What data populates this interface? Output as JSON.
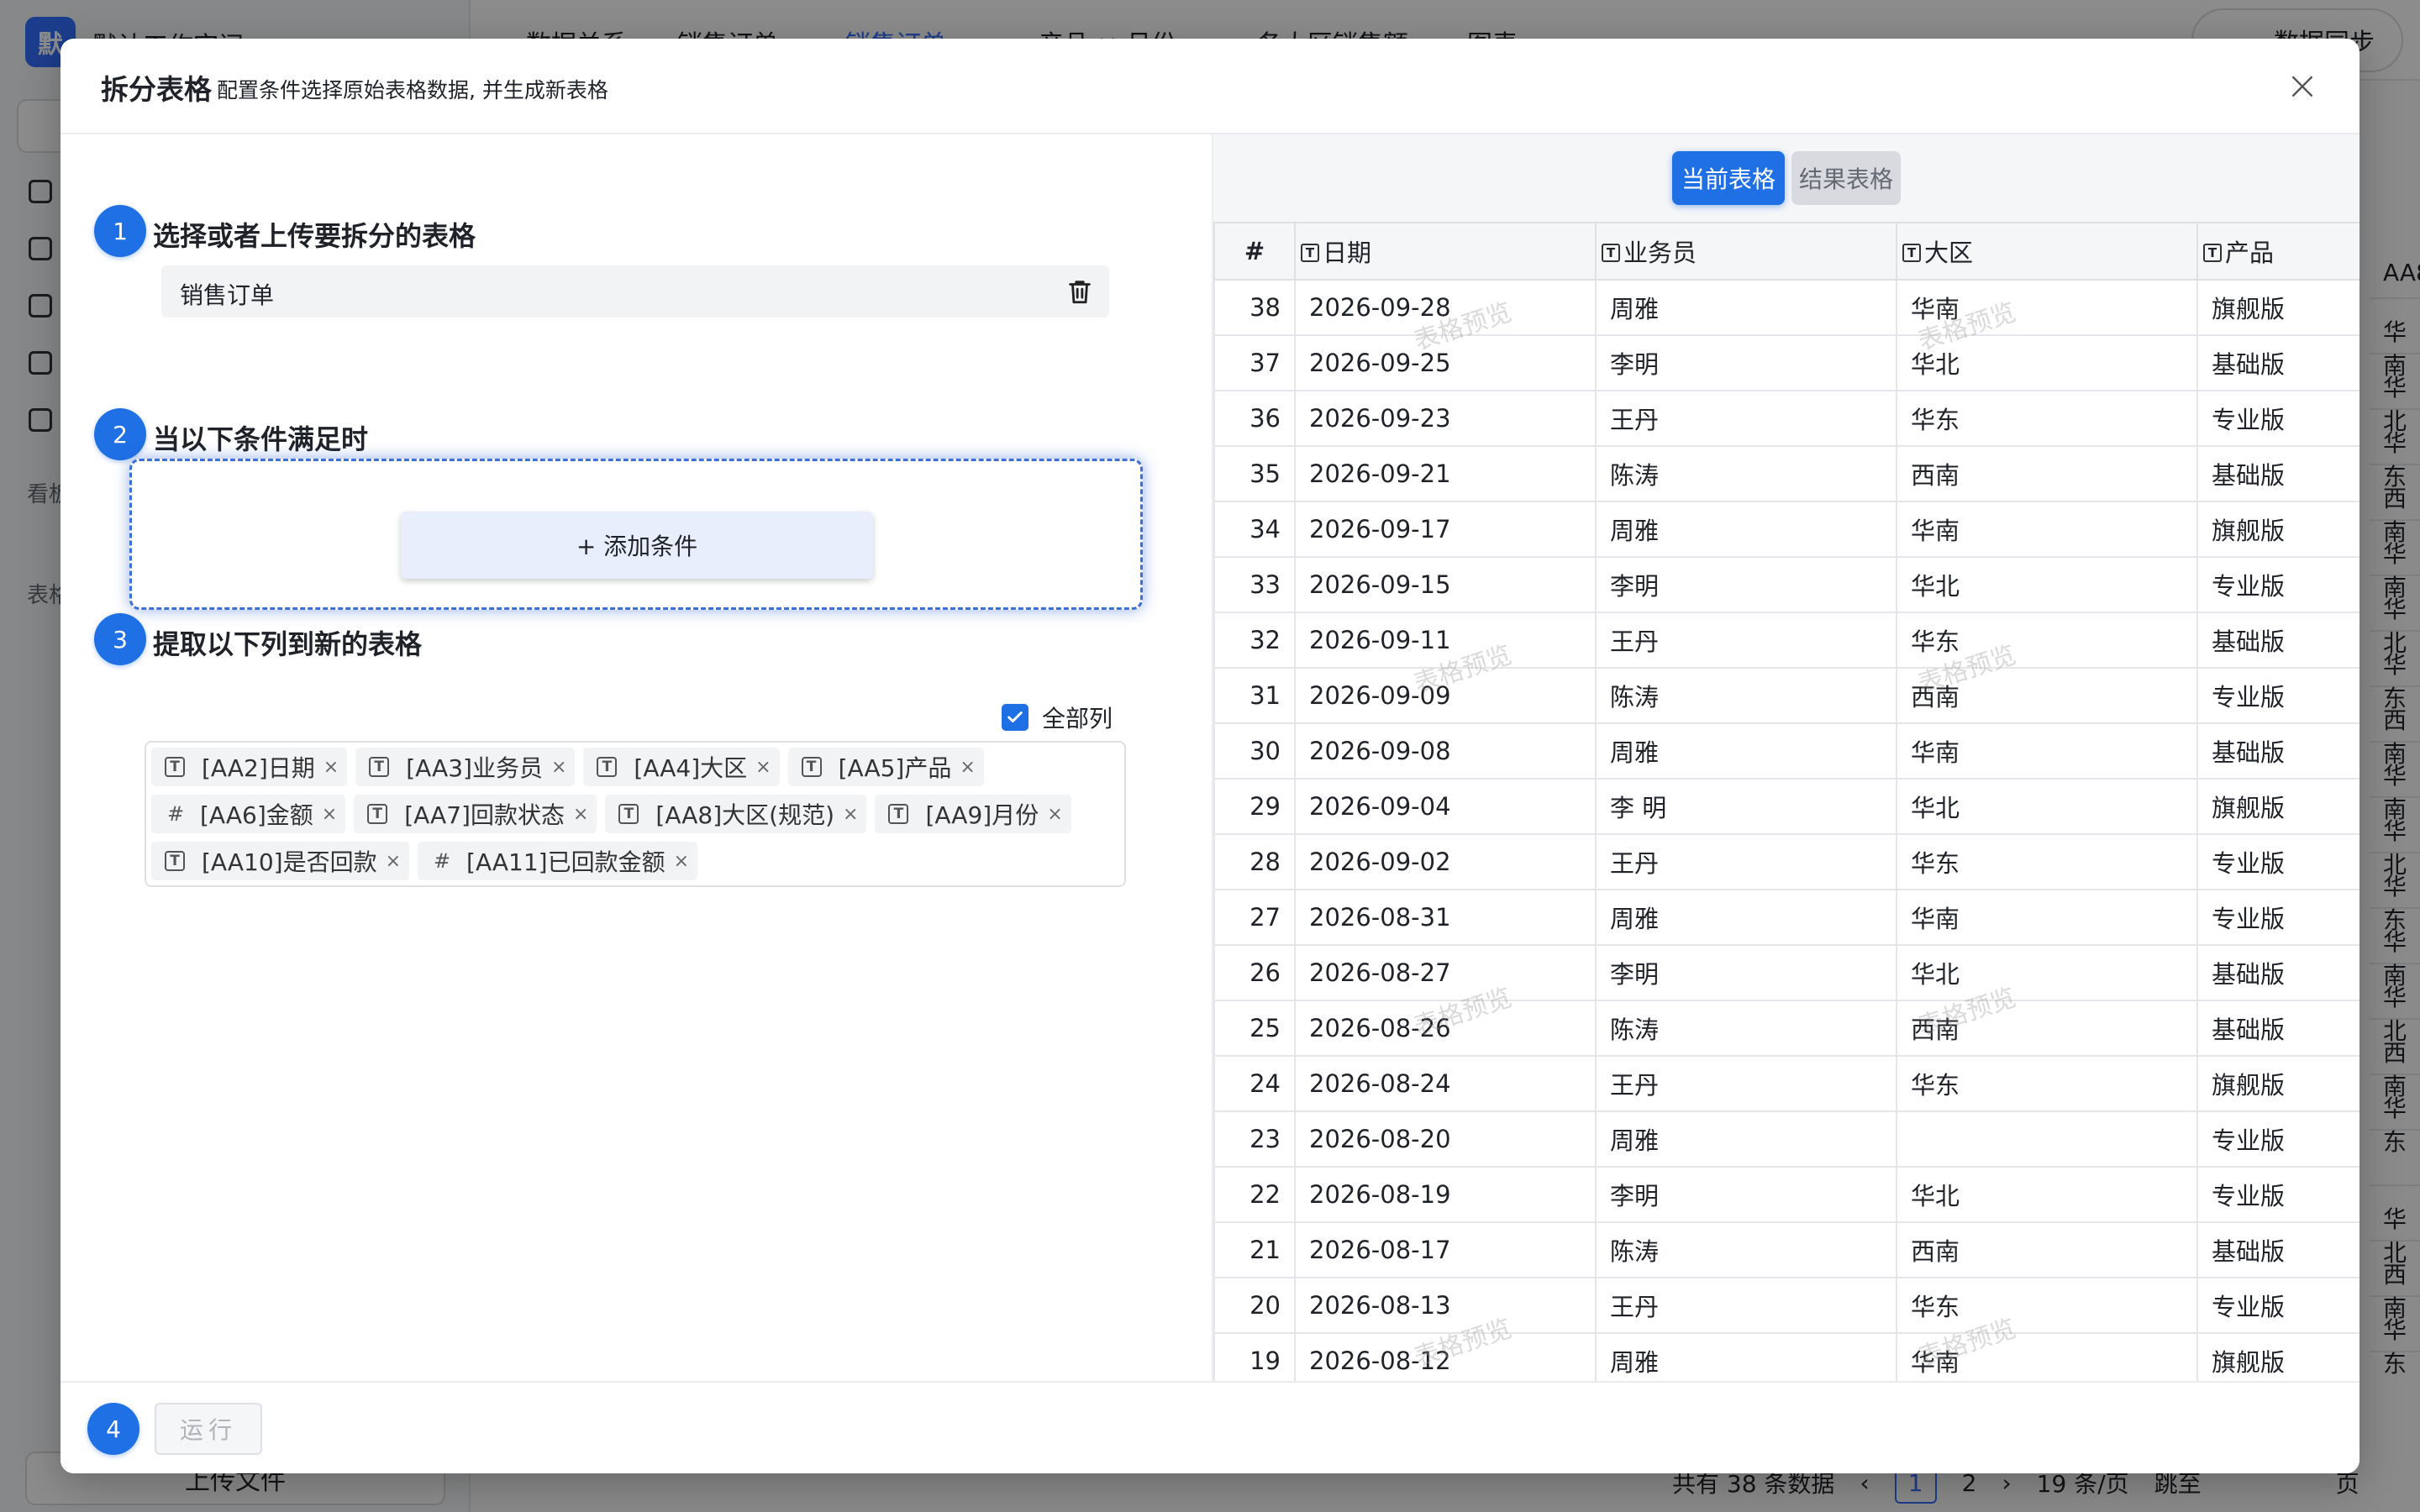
{
  "background": {
    "workspace_title": "默认工作空间",
    "logo_char": "默",
    "tabs": [
      "数据关系",
      "销售订单",
      "销售订单",
      "产品 × 月份",
      "各大区销售额",
      "图表"
    ],
    "sync_label": "数据同步",
    "side_labels": [
      "看板",
      "表格"
    ],
    "upload_label": "上传文件",
    "pager": {
      "total": "共有 38 条数据",
      "page1": "1",
      "page2": "2",
      "page_size": "19 条/页",
      "jump": "跳至",
      "page_unit": "页"
    },
    "right_cells": [
      "AA8",
      "华南",
      "华北",
      "华东",
      "西南",
      "华南",
      "华北",
      "华东",
      "西南",
      "华南",
      "华北",
      "华东",
      "华南",
      "华北",
      "西南",
      "华东",
      "",
      "华北",
      "西南",
      "华东"
    ]
  },
  "modal": {
    "title": "拆分表格",
    "subtitle": "配置条件选择原始表格数据, 并生成新表格",
    "close_symbol": "×"
  },
  "steps": [
    {
      "num": "1",
      "title": "选择或者上传要拆分的表格"
    },
    {
      "num": "2",
      "title": "当以下条件满足时"
    },
    {
      "num": "3",
      "title": "提取以下列到新的表格"
    },
    {
      "num": "4"
    }
  ],
  "selected_table": "销售订单",
  "add_condition_label": "+ 添加条件",
  "all_columns_label": "全部列",
  "all_columns_checked": true,
  "column_tags": [
    {
      "type": "text",
      "label": "[AA2]日期"
    },
    {
      "type": "text",
      "label": "[AA3]业务员"
    },
    {
      "type": "text",
      "label": "[AA4]大区"
    },
    {
      "type": "text",
      "label": "[AA5]产品"
    },
    {
      "type": "number",
      "label": "[AA6]金额"
    },
    {
      "type": "text",
      "label": "[AA7]回款状态"
    },
    {
      "type": "text",
      "label": "[AA8]大区(规范)"
    },
    {
      "type": "text",
      "label": "[AA9]月份"
    },
    {
      "type": "text",
      "label": "[AA10]是否回款"
    },
    {
      "type": "number",
      "label": "[AA11]已回款金额"
    }
  ],
  "run_label": "运行",
  "preview": {
    "tab_current": "当前表格",
    "tab_result": "结果表格",
    "watermark": "表格预览",
    "columns": [
      "#",
      "日期",
      "业务员",
      "大区",
      "产品"
    ],
    "rows": [
      [
        "38",
        "2026-09-28",
        "周雅",
        "华南",
        "旗舰版"
      ],
      [
        "37",
        "2026-09-25",
        "李明",
        "华北",
        "基础版"
      ],
      [
        "36",
        "2026-09-23",
        "王丹",
        "华东",
        "专业版"
      ],
      [
        "35",
        "2026-09-21",
        "陈涛",
        "西南",
        "基础版"
      ],
      [
        "34",
        "2026-09-17",
        "周雅",
        "华南",
        "旗舰版"
      ],
      [
        "33",
        "2026-09-15",
        "李明",
        "华北",
        "专业版"
      ],
      [
        "32",
        "2026-09-11",
        "王丹",
        "华东",
        "基础版"
      ],
      [
        "31",
        "2026-09-09",
        "陈涛",
        "西南",
        "专业版"
      ],
      [
        "30",
        "2026-09-08",
        "周雅",
        "华南",
        "基础版"
      ],
      [
        "29",
        "2026-09-04",
        "李 明",
        "华北",
        "旗舰版"
      ],
      [
        "28",
        "2026-09-02",
        "王丹",
        "华东",
        "专业版"
      ],
      [
        "27",
        "2026-08-31",
        "周雅",
        "华南",
        "专业版"
      ],
      [
        "26",
        "2026-08-27",
        "李明",
        "华北",
        "基础版"
      ],
      [
        "25",
        "2026-08-26",
        "陈涛",
        "西南",
        "基础版"
      ],
      [
        "24",
        "2026-08-24",
        "王丹",
        "华东",
        "旗舰版"
      ],
      [
        "23",
        "2026-08-20",
        "周雅",
        "",
        "专业版"
      ],
      [
        "22",
        "2026-08-19",
        "李明",
        "华北",
        "专业版"
      ],
      [
        "21",
        "2026-08-17",
        "陈涛",
        "西南",
        "基础版"
      ],
      [
        "20",
        "2026-08-13",
        "王丹",
        "华东",
        "专业版"
      ],
      [
        "19",
        "2026-08-12",
        "周雅",
        "华南",
        "旗舰版"
      ]
    ]
  }
}
